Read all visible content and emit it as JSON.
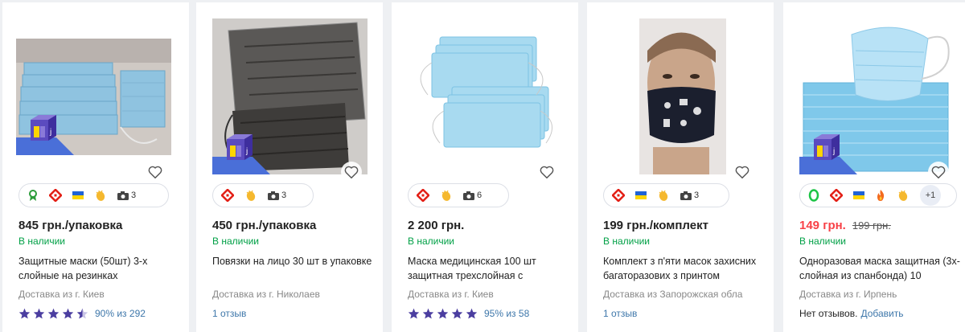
{
  "colors": {
    "in_stock": "#00a046",
    "link": "#3e77aa",
    "sale_price": "#f84147",
    "star": "#4b3ea0"
  },
  "products": [
    {
      "price": "845 грн./упаковка",
      "stock": "В наличии",
      "title": "Защитные маски (50шт) 3-х слойные на резинках",
      "delivery": "Доставка из г. Киев",
      "rating": {
        "percent": "90% из 292",
        "stars": 4.5
      },
      "chips": [
        "award-icon",
        "delivery-icon",
        "ukraine-flag-icon",
        "clap-icon",
        "camera-icon"
      ],
      "photo_count": "3"
    },
    {
      "price": "450 грн./упаковка",
      "stock": "В наличии",
      "title": "Повязки на лицо 30 шт в упаковке",
      "delivery": "Доставка из г. Николаев",
      "reviews": "1 отзыв",
      "chips": [
        "delivery-icon",
        "clap-icon",
        "camera-icon"
      ],
      "photo_count": "3"
    },
    {
      "price": "2 200 грн.",
      "stock": "В наличии",
      "title": "Маска медицинская 100 шт защитная трехслойная с",
      "delivery": "Доставка из г. Киев",
      "rating": {
        "percent": "95% из 58",
        "stars": 5
      },
      "chips": [
        "delivery-icon",
        "clap-icon",
        "camera-icon"
      ],
      "photo_count": "6"
    },
    {
      "price": "199 грн./комплект",
      "stock": "В наличии",
      "title": "Комплект з п'яти масок захисних багаторазових з принтом",
      "delivery": "Доставка из Запорожская обла",
      "reviews": "1 отзыв",
      "chips": [
        "delivery-icon",
        "ukraine-flag-icon",
        "clap-icon",
        "camera-icon"
      ],
      "photo_count": "3"
    },
    {
      "price": "149 грн.",
      "old_price": "199 грн.",
      "stock": "В наличии",
      "title": "Одноразовая маска защитная (3х-слойная из спанбонда) 10",
      "delivery": "Доставка из г. Ирпень",
      "no_reviews": "Нет отзывов.",
      "add_link": "Добавить",
      "chips": [
        "o-badge-icon",
        "delivery-icon",
        "ukraine-flag-icon",
        "fire-icon",
        "clap-icon"
      ],
      "more_count": "+1"
    }
  ]
}
